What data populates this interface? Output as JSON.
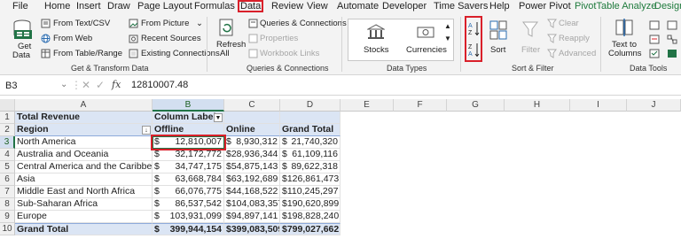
{
  "menu": {
    "tabs": [
      "File",
      "Home",
      "Insert",
      "Draw",
      "Page Layout",
      "Formulas",
      "Data",
      "Review",
      "View",
      "Automate",
      "Developer",
      "Time Savers",
      "Help",
      "Power Pivot",
      "PivotTable Analyze",
      "Design"
    ],
    "active": "Data"
  },
  "ribbon": {
    "get_transform": {
      "get_data": "Get",
      "get_data2": "Data",
      "from_text_csv": "From Text/CSV",
      "from_web": "From Web",
      "from_table_range": "From Table/Range",
      "from_picture": "From Picture",
      "recent_sources": "Recent Sources",
      "existing_connections": "Existing Connections",
      "label": "Get & Transform Data"
    },
    "queries": {
      "refresh_all": "Refresh",
      "refresh_all2": "All",
      "queries_connections": "Queries & Connections",
      "properties": "Properties",
      "workbook_links": "Workbook Links",
      "label": "Queries & Connections"
    },
    "data_types": {
      "stocks": "Stocks",
      "currencies": "Currencies",
      "label": "Data Types"
    },
    "sort_filter": {
      "sort": "Sort",
      "filter": "Filter",
      "clear": "Clear",
      "reapply": "Reapply",
      "advanced": "Advanced",
      "label": "Sort & Filter"
    },
    "data_tools": {
      "text_to_columns": "Text to",
      "text_to_columns2": "Columns",
      "label": "Data Tools"
    }
  },
  "formula_bar": {
    "name_box": "B3",
    "fx": "fx",
    "value": "12810007.48"
  },
  "columns": [
    "A",
    "B",
    "C",
    "D",
    "E",
    "F",
    "G",
    "H",
    "I",
    "J"
  ],
  "rows": [
    "1",
    "2",
    "3",
    "4",
    "5",
    "6",
    "7",
    "8",
    "9",
    "10"
  ],
  "pivot": {
    "a1": "Total Revenue",
    "b1": "Column Labels",
    "a2": "Region",
    "b2": "Offline",
    "c2": "Online",
    "d2": "Grand Total",
    "body": [
      {
        "region": "North America",
        "offline": "12,810,007",
        "online": "8,930,312",
        "total": "21,740,320"
      },
      {
        "region": "Australia and Oceania",
        "offline": "32,172,772",
        "online": "28,936,344",
        "total": "61,109,116"
      },
      {
        "region": "Central America and the Caribbean",
        "offline": "34,747,175",
        "online": "54,875,143",
        "total": "89,622,318"
      },
      {
        "region": "Asia",
        "offline": "63,668,784",
        "online": "63,192,689",
        "total": "126,861,473"
      },
      {
        "region": "Middle East and North Africa",
        "offline": "66,076,775",
        "online": "44,168,522",
        "total": "110,245,297"
      },
      {
        "region": "Sub-Saharan Africa",
        "offline": "86,537,542",
        "online": "104,083,357",
        "total": "190,620,899"
      },
      {
        "region": "Europe",
        "offline": "103,931,099",
        "online": "94,897,141",
        "total": "198,828,240"
      }
    ],
    "grand_total_label": "Grand Total",
    "grand_offline": "399,944,154",
    "grand_online": "399,083,509",
    "grand_total": "799,027,662",
    "currency": "$"
  }
}
